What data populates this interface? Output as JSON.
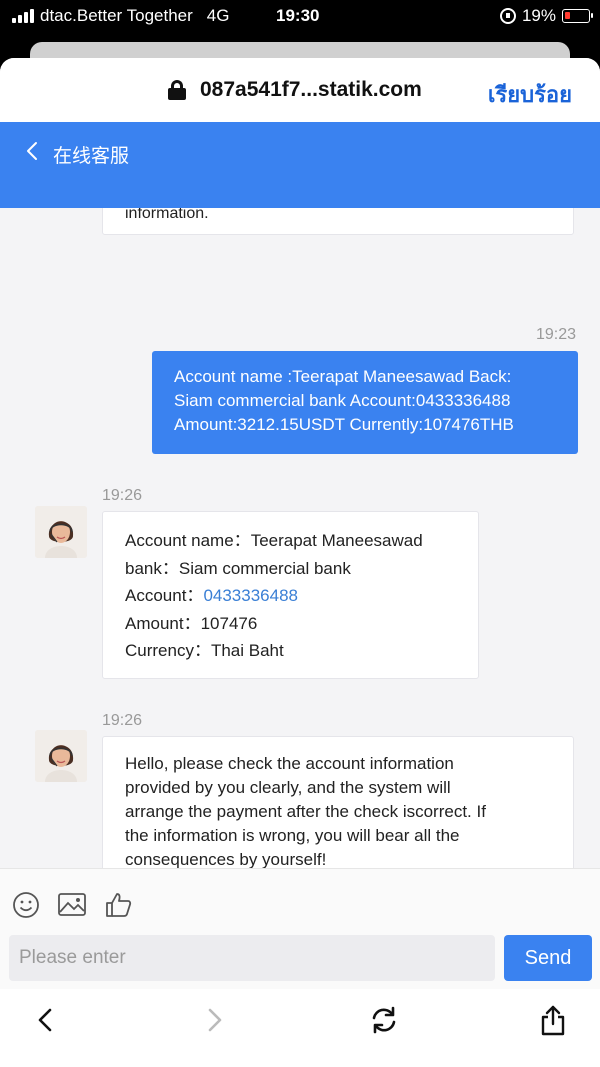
{
  "status_bar": {
    "carrier": "dtac.Better Together",
    "network": "4G",
    "time": "19:30",
    "battery": "19%",
    "battery_color": "#ff3b30"
  },
  "browser": {
    "url": "087a541f7...statik.com",
    "done_label": "เรียบร้อย"
  },
  "header": {
    "title": "在线客服",
    "color": "#3a82f0"
  },
  "chat": {
    "previous_fragment": "information.",
    "messages": [
      {
        "time": "19:23",
        "direction": "out",
        "lines": [
          "Account name :Teerapat Maneesawad Back:",
          "Siam commercial bank Account:0433336488",
          "Amount:3212.15USDT Currently:107476THB"
        ]
      },
      {
        "time": "19:26",
        "direction": "in",
        "rows": [
          {
            "label": "Account name：",
            "value": "Teerapat Maneesawad"
          },
          {
            "label": "bank：",
            "value": "Siam commercial bank"
          },
          {
            "label": "Account：",
            "value": "0433336488",
            "link": true
          },
          {
            "label": "Amount：",
            "value": "107476"
          },
          {
            "label": "Currency：",
            "value": "Thai Baht"
          }
        ]
      },
      {
        "time": "19:26",
        "direction": "in",
        "lines": [
          "Hello, please check the account information",
          "provided by you clearly, and the system will",
          "arrange the payment after the check iscorrect. If",
          "the information is wrong, you will bear all the",
          "consequences by yourself!"
        ]
      }
    ]
  },
  "composer": {
    "placeholder": "Please enter",
    "send_label": "Send",
    "tools": [
      "emoji-icon",
      "image-icon",
      "thumbs-up-icon"
    ]
  },
  "nav": {
    "icons": [
      "back-arrow-icon",
      "forward-arrow-icon",
      "reload-icon",
      "share-icon"
    ]
  }
}
